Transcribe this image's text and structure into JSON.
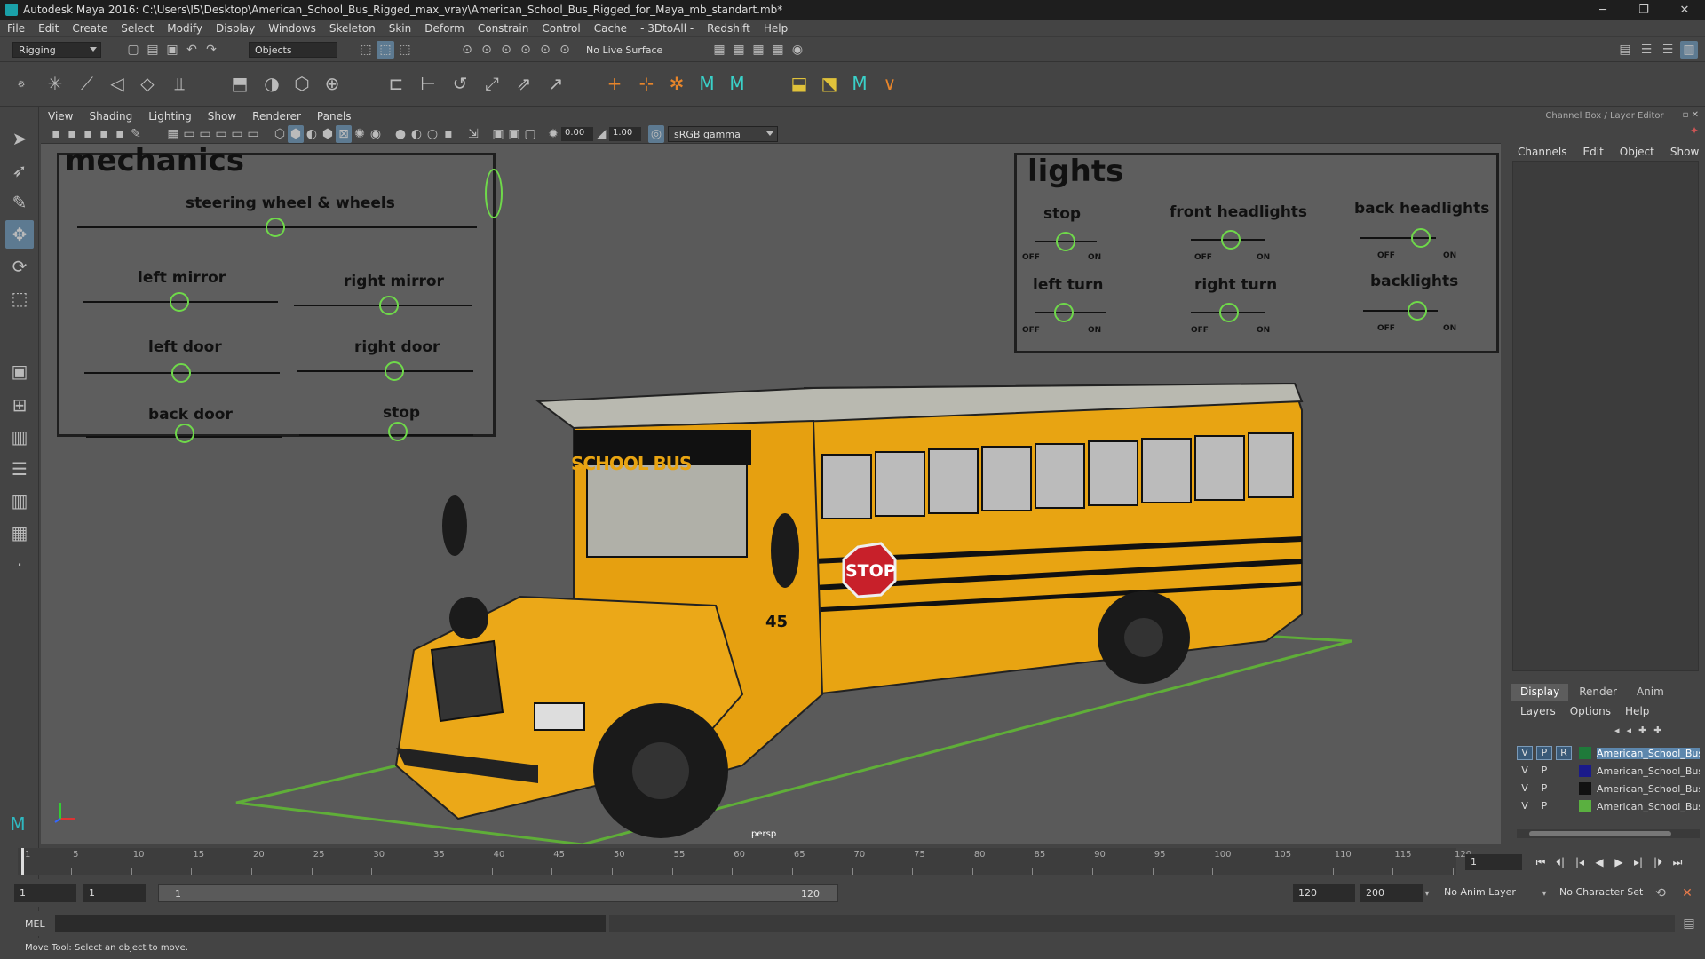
{
  "window": {
    "title": "Autodesk Maya 2016: C:\\Users\\I5\\Desktop\\American_School_Bus_Rigged_max_vray\\American_School_Bus_Rigged_for_Maya_mb_standart.mb*",
    "minimize": "─",
    "maximize": "❐",
    "close": "✕"
  },
  "menubar": [
    "File",
    "Edit",
    "Create",
    "Select",
    "Modify",
    "Display",
    "Windows",
    "Skeleton",
    "Skin",
    "Deform",
    "Constrain",
    "Control",
    "Cache",
    "- 3DtoAll -",
    "Redshift",
    "Help"
  ],
  "status": {
    "mode": "Rigging",
    "selection_mode": "Objects",
    "live_surface": "No Live Surface"
  },
  "viewport": {
    "menu": [
      "View",
      "Shading",
      "Lighting",
      "Show",
      "Renderer",
      "Panels"
    ],
    "field_a": "0.00",
    "field_b": "1.00",
    "colorspace": "sRGB gamma",
    "camera": "persp"
  },
  "mechanics_panel": {
    "title": "mechanics",
    "controls": [
      "steering wheel & wheels",
      "left mirror",
      "right mirror",
      "left door",
      "right door",
      "back door",
      "stop"
    ]
  },
  "lights_panel": {
    "title": "lights",
    "controls": [
      "stop",
      "front headlights",
      "back  headlights",
      "left turn",
      "right turn",
      "backlights"
    ],
    "off": "OFF",
    "on": "ON"
  },
  "bus": {
    "number": "45",
    "sign": "SCHOOL BUS",
    "stop_sign": "STOP"
  },
  "channel_box": {
    "header": "Channel Box / Layer Editor",
    "menu": [
      "Channels",
      "Edit",
      "Object",
      "Show"
    ],
    "tabs": [
      "Display",
      "Render",
      "Anim"
    ],
    "layer_menu": [
      "Layers",
      "Options",
      "Help"
    ],
    "layers": [
      {
        "v": "V",
        "p": "P",
        "r": "R",
        "color": "#1f7a3a",
        "name": "American_School_Bus_"
      },
      {
        "v": "V",
        "p": "P",
        "r": "",
        "color": "#1a1a8a",
        "name": "American_School_Bus_"
      },
      {
        "v": "V",
        "p": "P",
        "r": "",
        "color": "#111111",
        "name": "American_School_Bus_"
      },
      {
        "v": "V",
        "p": "P",
        "r": "",
        "color": "#5ab040",
        "name": "American_School_Bus_"
      }
    ]
  },
  "timeline": {
    "ticks": [
      "1",
      "5",
      "10",
      "15",
      "20",
      "25",
      "30",
      "35",
      "40",
      "45",
      "50",
      "55",
      "60",
      "65",
      "70",
      "75",
      "80",
      "85",
      "90",
      "95",
      "100",
      "105",
      "110",
      "115",
      "120"
    ],
    "current": "1"
  },
  "range": {
    "start": "1",
    "playback_start": "1",
    "slider_left": "1",
    "slider_right": "120",
    "playback_end": "120",
    "end": "200",
    "anim_layer": "No Anim Layer",
    "char_set": "No Character Set"
  },
  "cmd": {
    "label": "MEL"
  },
  "statusbar": {
    "message": "Move Tool: Select an object to move."
  }
}
